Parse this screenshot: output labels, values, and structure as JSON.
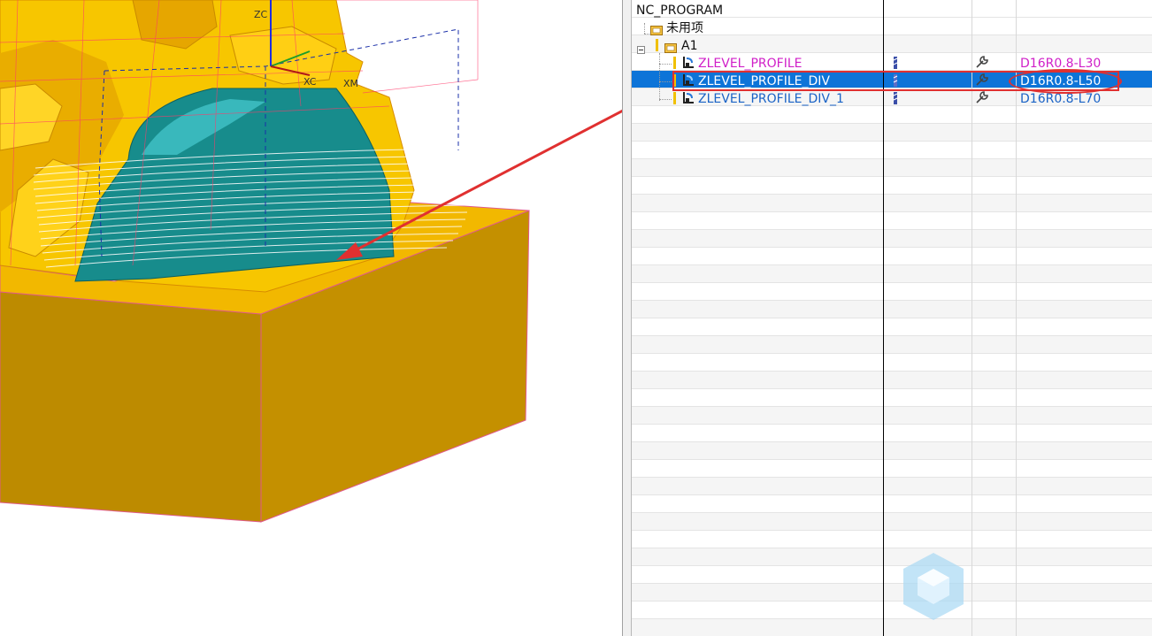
{
  "viewport": {
    "axis_labels": {
      "zc": "ZC",
      "xc": "XC",
      "xm": "XM"
    }
  },
  "navigator": {
    "header": "NC_PROGRAM",
    "unused_label": "未用项",
    "group_label": "A1",
    "operations": [
      {
        "name": "ZLEVEL_PROFILE",
        "tool": "D16R0.8-L30",
        "color": "#d01fc8",
        "selected": false
      },
      {
        "name": "ZLEVEL_PROFILE_DIV",
        "tool": "D16R0.8-L50",
        "color": "#ffffff",
        "selected": true
      },
      {
        "name": "ZLEVEL_PROFILE_DIV_1",
        "tool": "D16R0.8-L70",
        "color": "#1b63c6",
        "selected": false
      }
    ],
    "icons": {
      "collapse": "minus-box-icon",
      "folder": "program-folder-icon",
      "operation": "zlevel-operation-icon",
      "status": "toolpath-status-icon",
      "tool": "wrench-icon"
    }
  },
  "colors": {
    "selection": "#0d74d8",
    "annotation": "#e03030",
    "part_yellow": "#f5c000",
    "block_gold": "#c08e00",
    "surface_teal": "#1a8f8f"
  }
}
